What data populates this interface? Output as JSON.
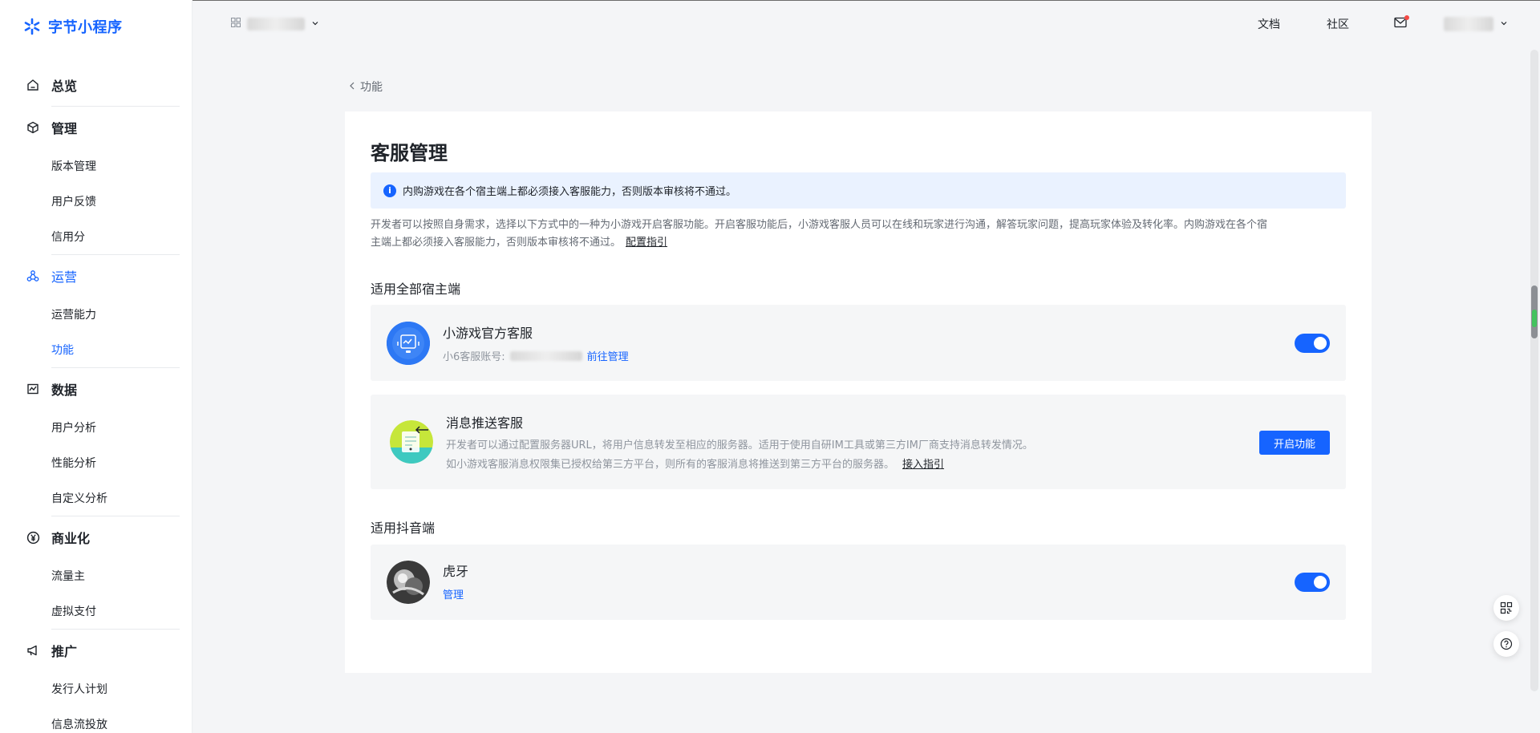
{
  "brand": {
    "name": "字节小程序",
    "color": "#1664ff"
  },
  "topbar": {
    "app_switch_icon": "grid-icon",
    "links": [
      "文档",
      "社区"
    ],
    "mail_icon": "mail-icon"
  },
  "sidebar": {
    "groups": [
      {
        "label": "总览",
        "icon": "home-icon",
        "items": []
      },
      {
        "label": "管理",
        "icon": "cube-icon",
        "items": [
          "版本管理",
          "用户反馈",
          "信用分"
        ]
      },
      {
        "label": "运营",
        "icon": "network-icon",
        "items": [
          "运营能力",
          "功能"
        ]
      },
      {
        "label": "数据",
        "icon": "chart-icon",
        "items": [
          "用户分析",
          "性能分析",
          "自定义分析"
        ]
      },
      {
        "label": "商业化",
        "icon": "yen-icon",
        "items": [
          "流量主",
          "虚拟支付"
        ]
      },
      {
        "label": "推广",
        "icon": "megaphone-icon",
        "items": [
          "发行人计划",
          "信息流投放"
        ]
      }
    ]
  },
  "breadcrumb": {
    "label": "功能"
  },
  "page": {
    "title": "客服管理",
    "notice": "内购游戏在各个宿主端上都必须接入客服能力，否则版本审核将不通过。",
    "desc_line1": "开发者可以按照自身需求，选择以下方式中的一种为小游戏开启客服功能。开启客服功能后，小游戏客服人员可以在线和玩家进行沟通，解答玩家问题，提高玩家体验及转化率。内购游戏在各个宿",
    "desc_line2": "主端上都必须接入客服能力，否则版本审核将不通过。",
    "desc_link": "配置指引",
    "section_all": "适用全部宿主端",
    "section_douyin": "适用抖音端"
  },
  "services": {
    "official": {
      "name": "小游戏官方客服",
      "account_label": "小6客服账号:",
      "manage_link": "前往管理",
      "enabled": true
    },
    "push": {
      "name": "消息推送客服",
      "line1": "开发者可以通过配置服务器URL，将用户信息转发至相应的服务器。适用于使用自研IM工具或第三方IM厂商支持消息转发情况。",
      "line2": "如小游戏客服消息权限集已授权给第三方平台，则所有的客服消息将推送到第三方平台的服务器。",
      "link": "接入指引",
      "button": "开启功能"
    },
    "huya": {
      "name": "虎牙",
      "manage_link": "管理",
      "enabled": true
    }
  },
  "floating": {
    "qr_icon": "qrcode-icon",
    "help_icon": "help-icon"
  }
}
